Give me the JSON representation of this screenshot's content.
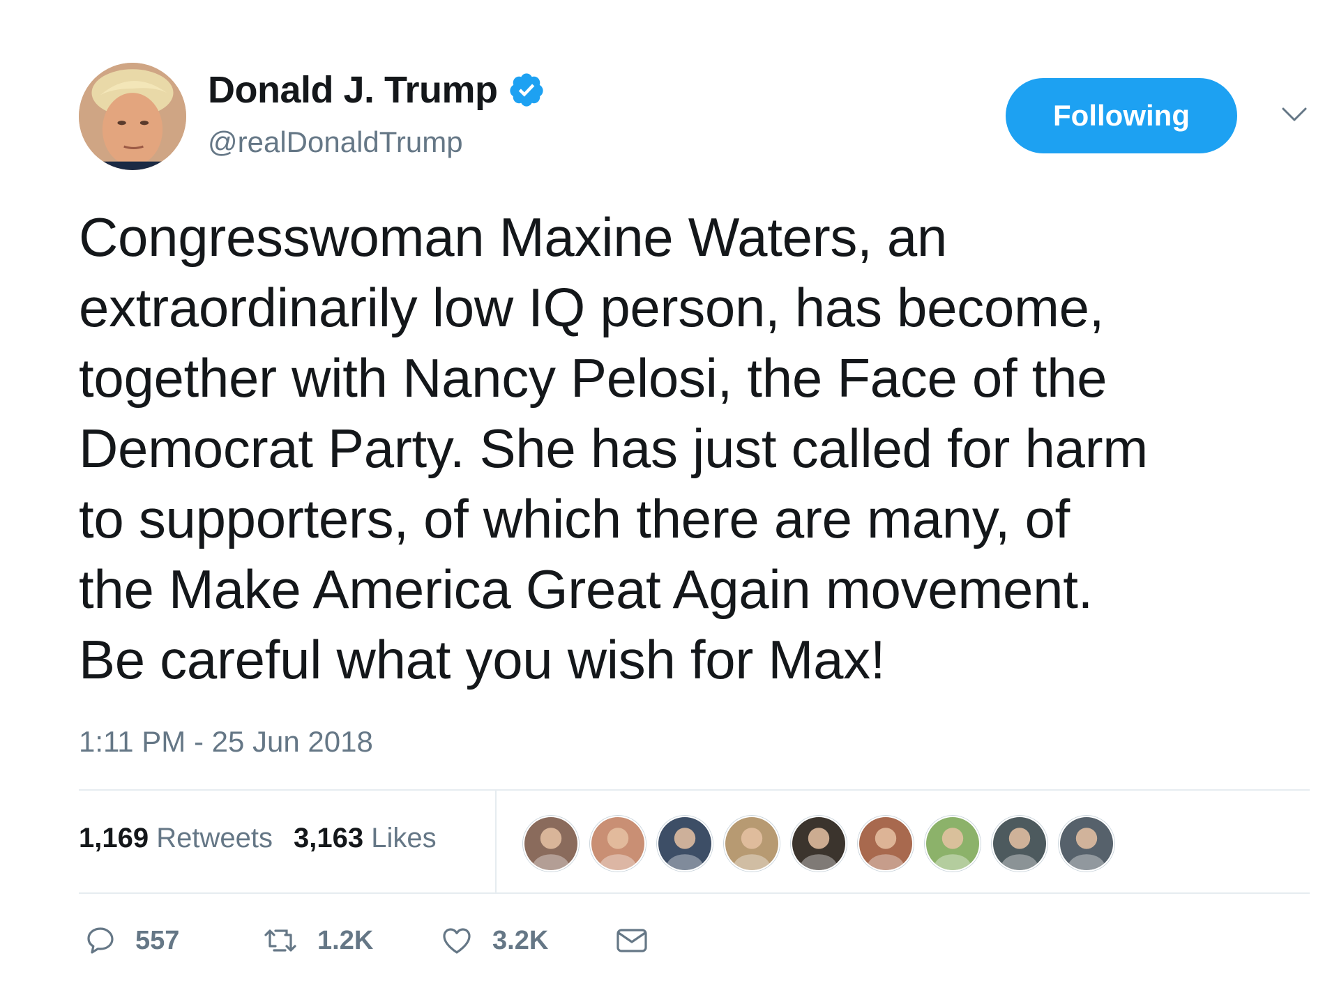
{
  "author": {
    "display_name": "Donald J. Trump",
    "handle": "@realDonaldTrump",
    "verified": true
  },
  "follow_button": {
    "label": "Following"
  },
  "tweet": {
    "lines": [
      "Congresswoman Maxine Waters, an",
      "extraordinarily low IQ person, has become,",
      "together with Nancy Pelosi, the Face of the",
      "Democrat Party. She has just called for harm",
      "to supporters, of which there are many, of",
      "the Make America Great Again movement.",
      "Be careful what you wish for Max!"
    ],
    "timestamp": "1:11 PM - 25 Jun 2018"
  },
  "stats": {
    "retweets_count": "1,169",
    "retweets_label": "Retweets",
    "likes_count": "3,163",
    "likes_label": "Likes"
  },
  "likers": [
    {
      "icon": "liker-avatar-icon",
      "color": "#8a6b5c"
    },
    {
      "icon": "liker-avatar-icon",
      "color": "#c98f74"
    },
    {
      "icon": "liker-avatar-icon",
      "color": "#3d4e66"
    },
    {
      "icon": "liker-avatar-icon",
      "color": "#b79a72"
    },
    {
      "icon": "liker-avatar-icon",
      "color": "#3b342d"
    },
    {
      "icon": "liker-avatar-icon",
      "color": "#a8694e"
    },
    {
      "icon": "liker-avatar-icon",
      "color": "#8cb26a"
    },
    {
      "icon": "liker-avatar-icon",
      "color": "#4d5a5e"
    },
    {
      "icon": "liker-avatar-icon",
      "color": "#56616b"
    }
  ],
  "actions": {
    "replies": "557",
    "retweets": "1.2K",
    "likes": "3.2K"
  },
  "colors": {
    "accent": "#1da1f2",
    "text": "#14171a",
    "muted": "#657786",
    "divider": "#e6ecf0"
  }
}
